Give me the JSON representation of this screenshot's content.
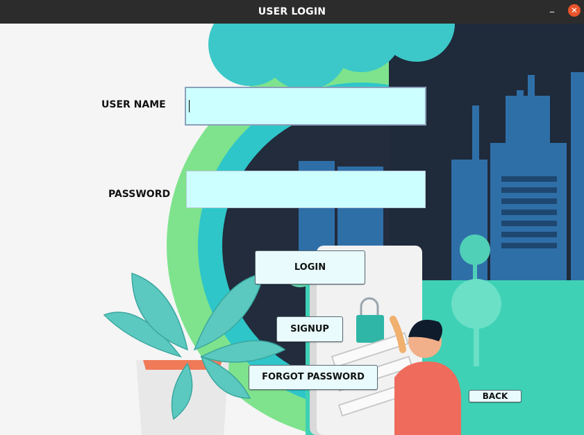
{
  "window": {
    "title": "USER LOGIN",
    "minimize_symbol": "–",
    "close_symbol": "✕"
  },
  "form": {
    "username_label": "USER NAME",
    "username_value": "",
    "password_label": "PASSWORD",
    "password_value": ""
  },
  "buttons": {
    "login": "LOGIN",
    "signup": "SIGNUP",
    "forgot": "FORGOT PASSWORD",
    "back": "BACK"
  },
  "colors": {
    "field_background": "#ccffff",
    "button_background": "#e9fbfc",
    "titlebar": "#2c2c2c",
    "close_button": "#e9542a"
  }
}
